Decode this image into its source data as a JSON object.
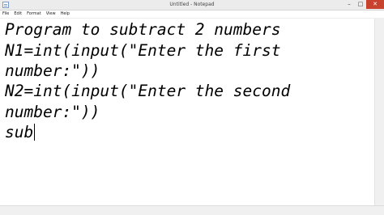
{
  "window": {
    "title": "Untitled - Notepad",
    "controls": {
      "minimize": "–",
      "maximize": "□",
      "close": "✕"
    }
  },
  "menu": {
    "items": [
      "File",
      "Edit",
      "Format",
      "View",
      "Help"
    ]
  },
  "editor": {
    "lines": [
      "Program to subtract 2 numbers",
      "N1=int(input(\"Enter the first",
      "number:\"))",
      "N2=int(input(\"Enter the second",
      "number:\"))",
      "sub"
    ]
  },
  "icons": {
    "app": "notepad-icon"
  }
}
